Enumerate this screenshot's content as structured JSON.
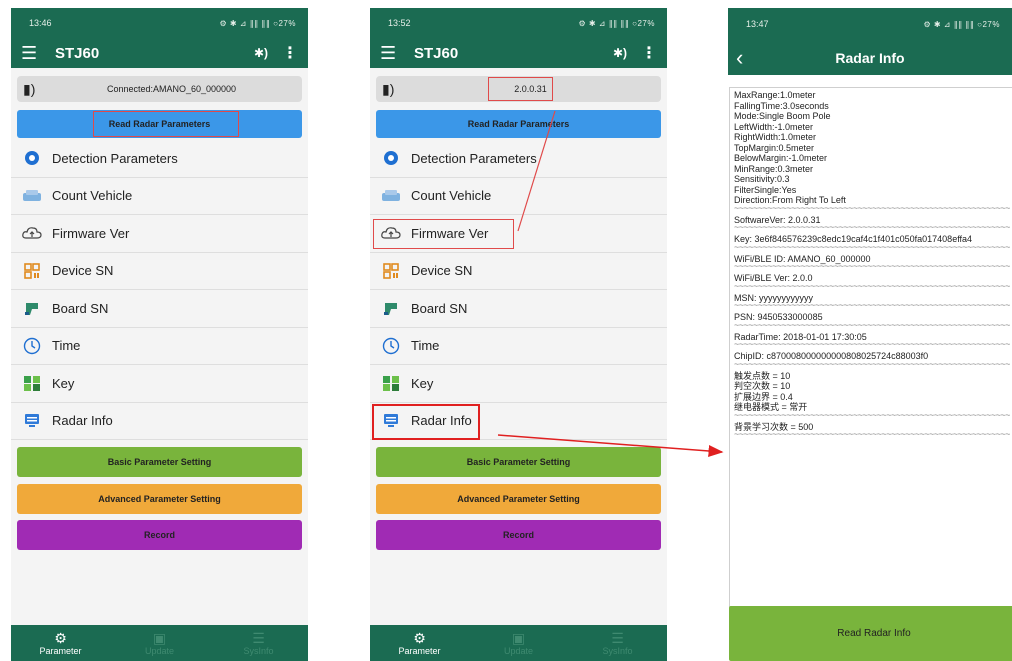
{
  "screen1": {
    "status_time": "13:46",
    "status_icons": "⚙ ✱ ⊿ ∥∥ ∥∥ ○27%",
    "app_title": "STJ60",
    "conn_text": "Connected:AMANO_60_000000",
    "read_btn": "Read Radar Parameters",
    "menu": [
      "Detection Parameters",
      "Count Vehicle",
      "Firmware Ver",
      "Device SN",
      "Board SN",
      "Time",
      "Key",
      "Radar Info"
    ],
    "basic_btn": "Basic Parameter Setting",
    "advanced_btn": "Advanced Parameter Setting",
    "record_btn": "Record",
    "nav": [
      "Parameter",
      "Update",
      "SysInfo"
    ]
  },
  "screen2": {
    "status_time": "13:52",
    "status_icons": "⚙ ✱ ⊿ ∥∥ ∥∥ ○27%",
    "app_title": "STJ60",
    "conn_text": "2.0.0.31",
    "read_btn": "Read Radar Parameters",
    "menu": [
      "Detection Parameters",
      "Count Vehicle",
      "Firmware Ver",
      "Device SN",
      "Board SN",
      "Time",
      "Key",
      "Radar Info"
    ],
    "basic_btn": "Basic Parameter Setting",
    "advanced_btn": "Advanced Parameter Setting",
    "record_btn": "Record",
    "nav": [
      "Parameter",
      "Update",
      "SysInfo"
    ]
  },
  "screen3": {
    "status_time": "13:47",
    "status_icons": "⚙ ✱ ⊿ ∥∥ ∥∥ ○27%",
    "title": "Radar Info",
    "params": [
      "MaxRange:1.0meter",
      "FallingTime:3.0seconds",
      "Mode:Single Boom Pole",
      "LeftWidth:-1.0meter",
      "RightWidth:1.0meter",
      "TopMargin:0.5meter",
      "BelowMargin:-1.0meter",
      "MinRange:0.3meter",
      "Sensitivity:0.3",
      "FilterSingle:Yes",
      "Direction:From Right To Left"
    ],
    "sections": [
      "SoftwareVer: 2.0.0.31",
      "Key: 3e6f846576239c8edc19caf4c1f401c050fa017408effa4",
      "WiFi/BLE ID: AMANO_60_000000",
      "WiFi/BLE Ver: 2.0.0",
      "MSN: yyyyyyyyyyyy",
      "PSN: 9450533000085",
      "RadarTime: 2018-01-01 17:30:05",
      "ChipID: c870008000000000808025724c88003f0"
    ],
    "cn_lines": [
      "触发点数 = 10",
      "判空次数 = 10",
      "扩展边界 = 0.4",
      "继电器模式 = 常开"
    ],
    "bg_line": "背景学习次数 = 500",
    "sep": "~~~~~~~~~~~~~~~~~~~~~~~~~~~~~~~~~~~~~~~~~~~~~~~~~~~~~~~~~~",
    "read_btn": "Read Radar Info"
  },
  "colors": {
    "app_green": "#1b6b52",
    "read_blue": "#3b97e8",
    "basic_green": "#79b43c",
    "advanced_orange": "#f0a93a",
    "record_purple": "#a02bb4",
    "annotation_red": "#e02020"
  },
  "icons": {
    "detection": "gear-icon",
    "count": "vehicle-icon",
    "firmware": "cloud-upload-icon",
    "device_sn": "qr-code-icon",
    "board_sn": "scanner-icon",
    "time": "clock-icon",
    "key": "shield-key-icon",
    "radar": "monitor-icon"
  }
}
